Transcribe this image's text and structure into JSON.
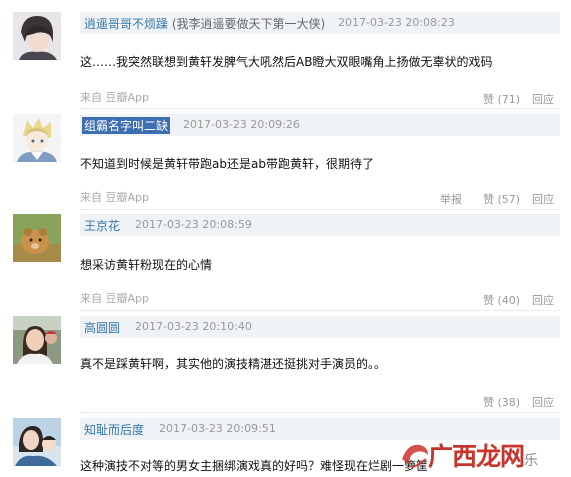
{
  "comments": [
    {
      "username": "逍遥哥哥不烦躁",
      "nickname": "(我李逍遥要做天下第一大侠)",
      "time": "2017-03-23 20:08:23",
      "text": "这……我突然联想到黄轩发脾气大吼然后AB瞪大双眼嘴角上扬做无辜状的戏码",
      "source": "来自 豆瓣App",
      "like": "赞 (71)",
      "reply": "回应"
    },
    {
      "username": "组霸名字叫二缺",
      "time": "2017-03-23 20:09:26",
      "text": "不知道到时候是黄轩带跑ab还是ab带跑黄轩，很期待了",
      "source": "来自 豆瓣App",
      "report": "举报",
      "like": "赞 (57)",
      "reply": "回应"
    },
    {
      "username": "王京花",
      "time": "2017-03-23 20:08:59",
      "text": "想采访黄轩粉现在的心情",
      "source": "来自 豆瓣App",
      "like": "赞 (40)",
      "reply": "回应"
    },
    {
      "username": "高圆圆",
      "time": "2017-03-23 20:10:40",
      "text": "真不是踩黄轩啊，其实他的演技精湛还挺挑对手演员的。。",
      "like": "赞 (38)",
      "reply": "回应"
    },
    {
      "username": "知耻而后度",
      "time": "2017-03-23 20:09:51",
      "text": "这种演技不对等的男女主捆绑演戏真的好吗？难怪现在烂剧一箩筐"
    }
  ],
  "watermark": {
    "brand": "广西龙网",
    "suffix": "乐"
  },
  "colors": {
    "link": "#3377aa",
    "header_bg": "#f0f3f5",
    "selection": "#3d6fb0",
    "watermark": "#c8342a"
  }
}
